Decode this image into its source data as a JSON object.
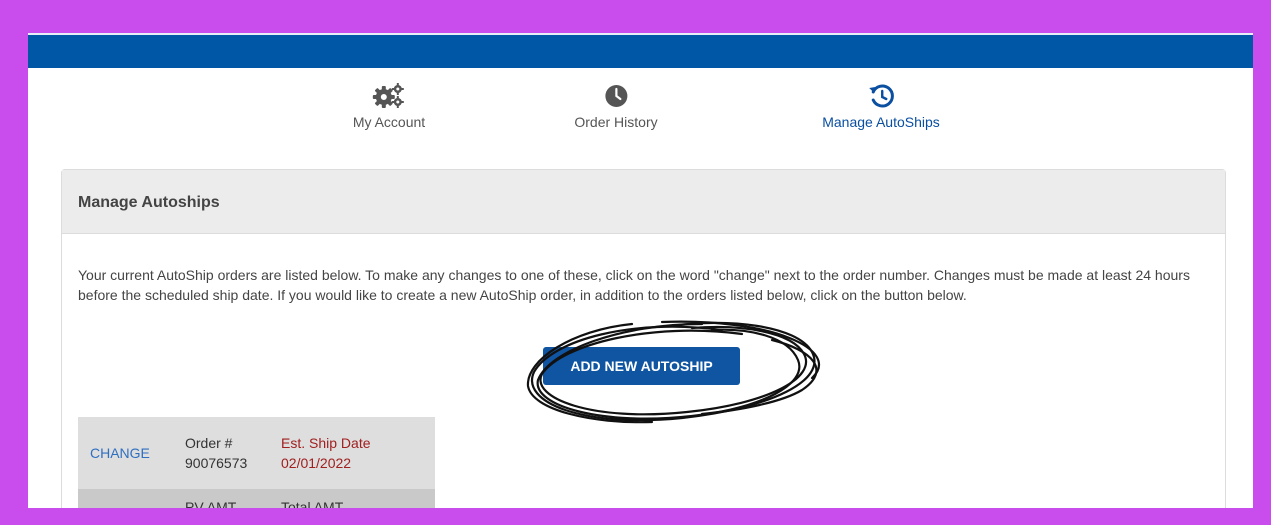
{
  "nav": {
    "items": [
      {
        "label": "My Account",
        "icon": "gears-icon",
        "active": false
      },
      {
        "label": "Order History",
        "icon": "clock-icon",
        "active": false
      },
      {
        "label": "Manage AutoShips",
        "icon": "history-icon",
        "active": true
      }
    ]
  },
  "panel": {
    "title": "Manage Autoships",
    "intro": "Your current AutoShip orders are listed below. To make any changes to one of these, click on the word \"change\" next to the order number. Changes must be made at least 24 hours before the scheduled ship date. If you would like to create a new AutoShip order, in addition to the orders listed below, click on the button below.",
    "add_button": "ADD NEW AUTOSHIP"
  },
  "orders": [
    {
      "change_label": "CHANGE",
      "order_label": "Order #",
      "order_number": "90076573",
      "ship_label": "Est. Ship Date",
      "ship_date": "02/01/2022",
      "pv_label": "PV AMT",
      "total_label": "Total AMT"
    }
  ],
  "colors": {
    "background": "#c94ced",
    "topbar": "#0057a5",
    "accent": "#0f55a2",
    "ship_date": "#a01f1f"
  }
}
